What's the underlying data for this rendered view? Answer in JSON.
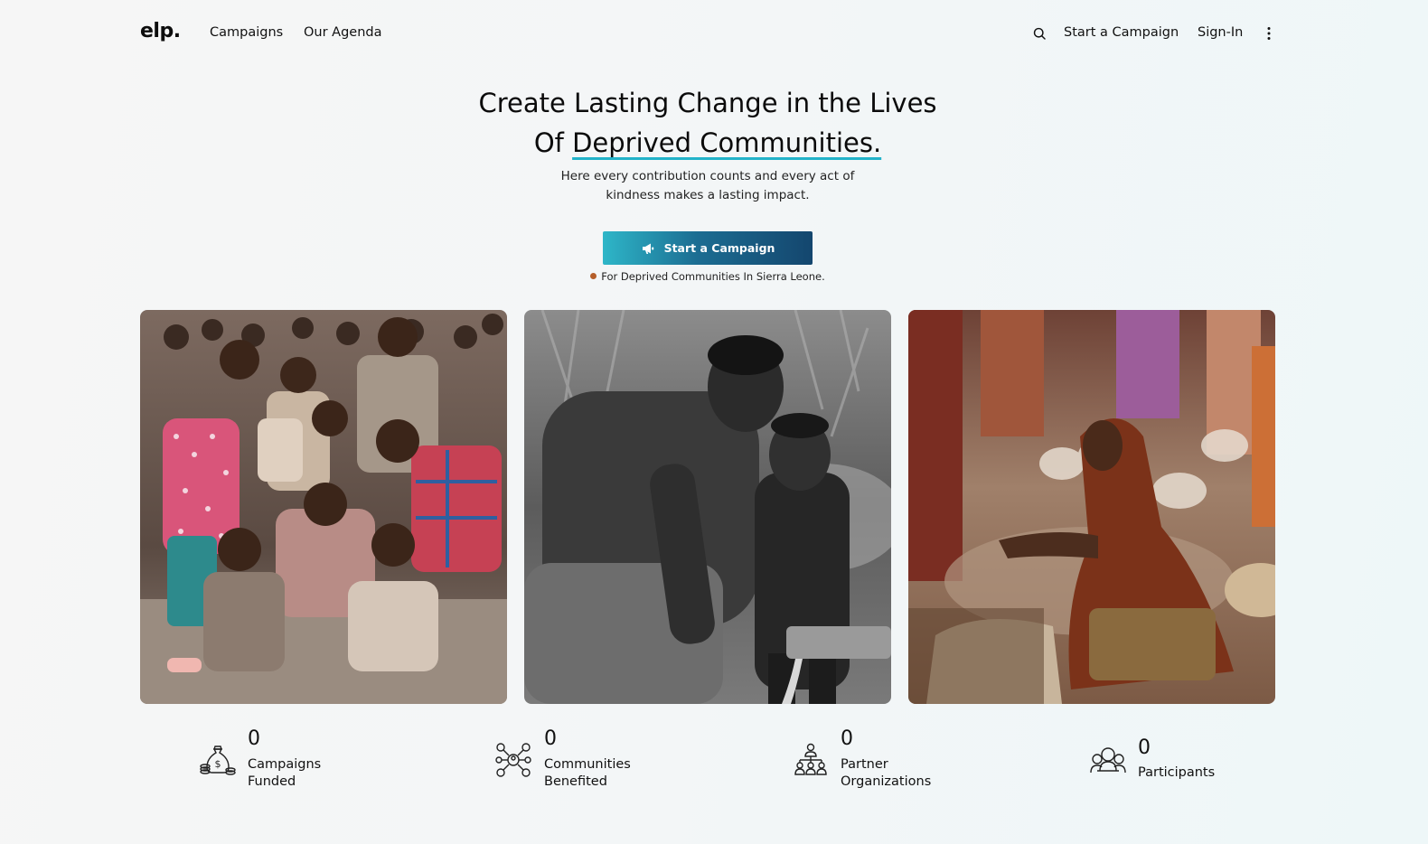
{
  "header": {
    "logo": "elp.",
    "nav": {
      "campaigns": "Campaigns",
      "agenda": "Our Agenda",
      "start_campaign": "Start a Campaign",
      "sign_in": "Sign-In"
    }
  },
  "hero": {
    "title_line1": "Create Lasting Change in the Lives",
    "title_line2_prefix": "Of ",
    "title_line2_highlight": "Deprived Communities.",
    "subtitle_line1": "Here every contribution counts and every act of",
    "subtitle_line2": "kindness makes a lasting impact.",
    "cta_label": "Start a Campaign",
    "note": "For Deprived Communities In Sierra Leone."
  },
  "photos": [
    {
      "subject": "group of children"
    },
    {
      "subject": "woman and child at water pump"
    },
    {
      "subject": "woman at market"
    }
  ],
  "stats": [
    {
      "value": "0",
      "label_line1": "Campaigns",
      "label_line2": "Funded",
      "icon": "money-bag-icon"
    },
    {
      "value": "0",
      "label_line1": "Communities",
      "label_line2": "Benefited",
      "icon": "network-icon"
    },
    {
      "value": "0",
      "label_line1": "Partner",
      "label_line2": "Organizations",
      "icon": "organization-icon"
    },
    {
      "value": "0",
      "label_line1": "Participants",
      "label_line2": "",
      "icon": "people-icon"
    }
  ],
  "colors": {
    "accent": "#22b3c9",
    "button_start": "#2eb6c8",
    "button_end": "#14466e",
    "note_dot": "#b55e2a"
  }
}
